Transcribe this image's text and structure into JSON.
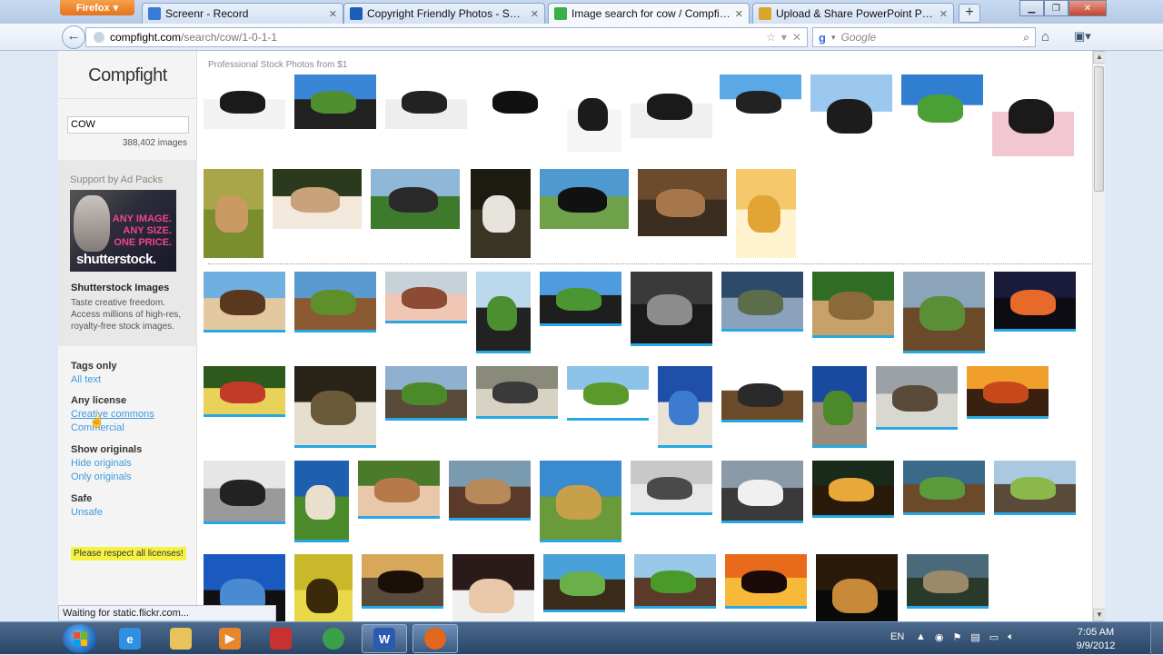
{
  "browser": {
    "app_button": "Firefox",
    "tabs": [
      {
        "title": "Screenr - Record",
        "active": false,
        "favicon_color": "#3a7ad8"
      },
      {
        "title": "Copyright Friendly Photos - Senior Pr...",
        "active": false,
        "favicon_color": "#1d5db7"
      },
      {
        "title": "Image search for cow / Compfight / ...",
        "active": true,
        "favicon_color": "#3bb04a"
      },
      {
        "title": "Upload & Share PowerPoint Presenta...",
        "active": false,
        "favicon_color": "#d8a62a"
      }
    ],
    "new_tab_label": "+",
    "url_domain": "compfight.com",
    "url_path": "/search/cow/1-0-1-1",
    "search_placeholder": "Google",
    "status_text": "Waiting for static.flickr.com..."
  },
  "sidebar": {
    "logo": "Compfight",
    "query": "COW",
    "result_count": "388,402 images",
    "ad": {
      "label": "Support by Ad Packs",
      "lines": [
        "ANY IMAGE.",
        "ANY SIZE.",
        "ONE PRICE."
      ],
      "brand": "shutterstock.",
      "heading": "Shutterstock Images",
      "text": "Taste creative freedom. Access millions of high-res, royalty-free stock images."
    },
    "filters": [
      {
        "heading": "Tags only",
        "links": [
          "All text"
        ]
      },
      {
        "heading": "Any license",
        "links": [
          "Creative commons",
          "Commercial"
        ]
      },
      {
        "heading": "Show originals",
        "links": [
          "Hide originals",
          "Only originals"
        ]
      },
      {
        "heading": "Safe",
        "links": [
          "Unsafe"
        ]
      }
    ],
    "notice": "Please respect all licenses!"
  },
  "main": {
    "stock_label": "Professional Stock Photos from $1",
    "thumbnails": [
      {
        "type": "stock",
        "colors": [
          "#ffffff",
          "#1a1a1a",
          "#f2f2f2"
        ]
      },
      {
        "type": "stock",
        "colors": [
          "#3a86d6",
          "#4f8f2f",
          "#222222"
        ]
      },
      {
        "type": "stock",
        "colors": [
          "#ffffff",
          "#222222",
          "#eeeeee"
        ]
      },
      {
        "type": "stock",
        "colors": [
          "#ffffff",
          "#111111",
          "#ffffff"
        ]
      },
      {
        "type": "stock",
        "colors": [
          "#ffffff",
          "#1b1b1b",
          "#f5f5f5"
        ]
      },
      {
        "type": "stock",
        "colors": [
          "#ffffff",
          "#1a1a1a",
          "#f0f0f0"
        ]
      },
      {
        "type": "stock",
        "colors": [
          "#5aa8e6",
          "#222222",
          "#ffffff"
        ]
      },
      {
        "type": "stock",
        "colors": [
          "#9cc7ef",
          "#1c1c1c",
          "#ffffff"
        ]
      },
      {
        "type": "stock",
        "colors": [
          "#2f7ed0",
          "#4aa034",
          "#ffffff"
        ]
      },
      {
        "type": "stock",
        "colors": [
          "#ffffff",
          "#1a1a1a",
          "#f3c7d2"
        ]
      },
      {
        "type": "stock",
        "colors": [
          "#a9a64a",
          "#c99a62",
          "#7a8e2e"
        ]
      },
      {
        "type": "stock",
        "colors": [
          "#2b3a1d",
          "#c7a27a",
          "#f2e8dc"
        ]
      },
      {
        "type": "stock",
        "colors": [
          "#8fb8d8",
          "#2a2a2a",
          "#3d7a2c"
        ]
      },
      {
        "type": "stock",
        "colors": [
          "#1d1a12",
          "#e6e3dc",
          "#3a3424"
        ]
      },
      {
        "type": "stock",
        "colors": [
          "#4e9ad0",
          "#111111",
          "#6fa04a"
        ]
      },
      {
        "type": "stock",
        "colors": [
          "#6b4a2e",
          "#a7764a",
          "#3b2d20"
        ]
      },
      {
        "type": "stock",
        "colors": [
          "#f5c86b",
          "#e3a436",
          "#fff2cf"
        ]
      },
      {
        "type": "cc",
        "colors": [
          "#6fb0e0",
          "#5a3820",
          "#e4c8a0"
        ]
      },
      {
        "type": "cc",
        "colors": [
          "#5a9ad0",
          "#5d8f2a",
          "#8a5a32"
        ]
      },
      {
        "type": "cc",
        "colors": [
          "#c7d2d8",
          "#8d4a34",
          "#f0c6b4"
        ]
      },
      {
        "type": "cc",
        "colors": [
          "#bcd8ec",
          "#4b8f30",
          "#222222"
        ]
      },
      {
        "type": "cc",
        "colors": [
          "#4f9be0",
          "#4a9632",
          "#1e1e1e"
        ]
      },
      {
        "type": "cc",
        "colors": [
          "#3a3a3a",
          "#8c8c8c",
          "#1a1a1a"
        ]
      },
      {
        "type": "cc",
        "colors": [
          "#2d4a6b",
          "#5b6d4a",
          "#8aa2bc"
        ]
      },
      {
        "type": "cc",
        "colors": [
          "#2f6c24",
          "#8a6a3b",
          "#c7a06a"
        ]
      },
      {
        "type": "cc",
        "colors": [
          "#8ba4ba",
          "#5a8f38",
          "#6b4a2a"
        ]
      },
      {
        "type": "cc",
        "colors": [
          "#1a1a3a",
          "#e86a2a",
          "#0c0c12"
        ]
      },
      {
        "type": "cc",
        "colors": [
          "#2d5a1c",
          "#c33a2a",
          "#e8d25a"
        ]
      },
      {
        "type": "cc",
        "colors": [
          "#2a2418",
          "#6b5a3a",
          "#e6dfd0"
        ]
      },
      {
        "type": "cc",
        "colors": [
          "#8fb1cf",
          "#4b8a2a",
          "#5a4a3a"
        ]
      },
      {
        "type": "cc",
        "colors": [
          "#8a8a7a",
          "#3a3a3a",
          "#d8d2c5"
        ]
      },
      {
        "type": "cc",
        "colors": [
          "#8dc3e8",
          "#5a9a2a",
          "#ffffff"
        ]
      },
      {
        "type": "cc",
        "colors": [
          "#1f4fa8",
          "#3c7bd0",
          "#e9e3d6"
        ]
      },
      {
        "type": "cc",
        "colors": [
          "#ffffff",
          "#2a2a2a",
          "#6b4a2a"
        ]
      },
      {
        "type": "cc",
        "colors": [
          "#1a4aa0",
          "#4a8a2a",
          "#9a8a7a"
        ]
      },
      {
        "type": "cc",
        "colors": [
          "#9aa2a8",
          "#5a4a3a",
          "#d8d8d0"
        ]
      },
      {
        "type": "cc",
        "colors": [
          "#f0a02a",
          "#c84a1a",
          "#3a2010"
        ]
      },
      {
        "type": "cc",
        "colors": [
          "#e6e6e6",
          "#222222",
          "#9a9a9a"
        ]
      },
      {
        "type": "cc",
        "colors": [
          "#1f5fb0",
          "#e8e0cc",
          "#4a8a2a"
        ]
      },
      {
        "type": "cc",
        "colors": [
          "#4a7a2a",
          "#b67a4a",
          "#e8c8a8"
        ]
      },
      {
        "type": "cc",
        "colors": [
          "#7a9ab0",
          "#b88a5a",
          "#5a3a2a"
        ]
      },
      {
        "type": "cc",
        "colors": [
          "#3a8ad0",
          "#c8a04a",
          "#6a9a3a"
        ]
      },
      {
        "type": "cc",
        "colors": [
          "#c8c8c8",
          "#4a4a4a",
          "#e8e8e8"
        ]
      },
      {
        "type": "cc",
        "colors": [
          "#8a9aa8",
          "#f0f0f0",
          "#3a3a3a"
        ]
      },
      {
        "type": "cc",
        "colors": [
          "#1a2a1a",
          "#e8a83a",
          "#2a1a0a"
        ]
      },
      {
        "type": "cc",
        "colors": [
          "#3a6a8a",
          "#5a9a3a",
          "#6a4a2a"
        ]
      },
      {
        "type": "cc",
        "colors": [
          "#aac8e0",
          "#8ab84a",
          "#5a4a3a"
        ]
      },
      {
        "type": "cc",
        "colors": [
          "#1a5ac0",
          "#4a8ad0",
          "#111111"
        ]
      },
      {
        "type": "cc",
        "colors": [
          "#c8b82a",
          "#3a2a0a",
          "#e8d84a"
        ]
      },
      {
        "type": "cc",
        "colors": [
          "#d8a85a",
          "#1a1008",
          "#5a4a3a"
        ]
      },
      {
        "type": "cc",
        "colors": [
          "#2a1a1a",
          "#e8c8a8",
          "#f0f0f0"
        ]
      },
      {
        "type": "cc",
        "colors": [
          "#4aa0d8",
          "#6ab04a",
          "#3a2a1a"
        ]
      },
      {
        "type": "cc",
        "colors": [
          "#9ac8e8",
          "#4a9a2a",
          "#5a3a2a"
        ]
      },
      {
        "type": "cc",
        "colors": [
          "#e86a1a",
          "#1a0a0a",
          "#f8b83a"
        ]
      },
      {
        "type": "cc",
        "colors": [
          "#2a1a0a",
          "#c88a3a",
          "#0a0a0a"
        ]
      },
      {
        "type": "cc",
        "colors": [
          "#4a6a7a",
          "#9a8a6a",
          "#2a3a2a"
        ]
      }
    ]
  },
  "taskbar": {
    "apps": [
      {
        "name": "internet-explorer",
        "glyph": "e",
        "color": "#2f8fe0",
        "open": false
      },
      {
        "name": "file-explorer",
        "glyph": "",
        "color": "#e8c25a",
        "open": false
      },
      {
        "name": "media-player",
        "glyph": "▶",
        "color": "#e8862a",
        "open": false
      },
      {
        "name": "recorder",
        "glyph": "",
        "color": "#c93030",
        "open": false
      },
      {
        "name": "chrome",
        "glyph": "",
        "color": "#3aa04a",
        "open": false
      },
      {
        "name": "word",
        "glyph": "W",
        "color": "#2b5bb0",
        "open": true
      },
      {
        "name": "firefox",
        "glyph": "",
        "color": "#e2661c",
        "open": true
      }
    ],
    "language": "EN",
    "time": "7:05 AM",
    "date": "9/9/2012"
  }
}
